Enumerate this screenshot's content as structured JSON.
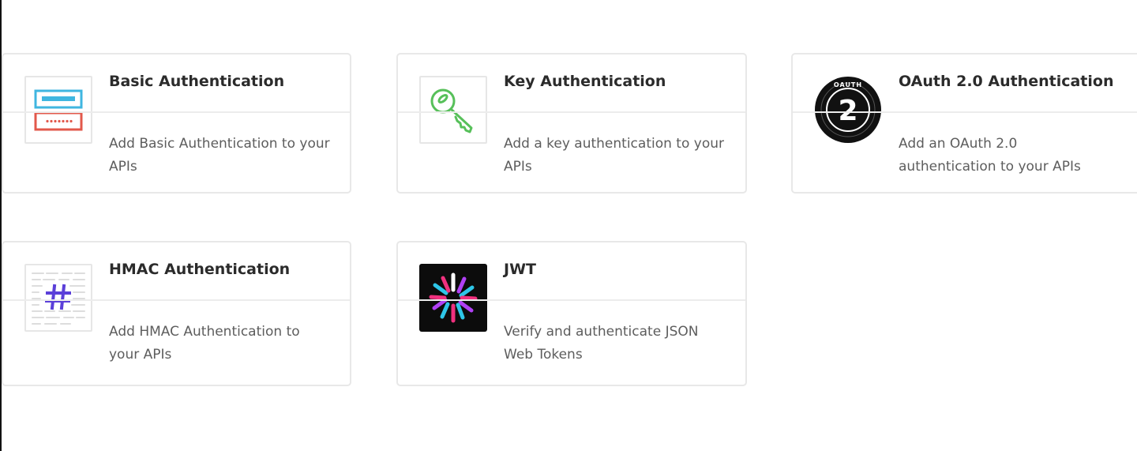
{
  "plugins": [
    {
      "title": "Basic Authentication",
      "description": "Add Basic Authentication to your APIs",
      "icon": "basic-auth-icon"
    },
    {
      "title": "Key Authentication",
      "description": "Add a key authentication to your APIs",
      "icon": "key-icon"
    },
    {
      "title": "OAuth 2.0 Authentication",
      "description": "Add an OAuth 2.0 authentication to your APIs",
      "icon": "oauth2-icon",
      "icon_text": "2",
      "badge_text": "OAUTH"
    },
    {
      "title": "HMAC Authentication",
      "description": "Add HMAC Authentication to your APIs",
      "icon": "hmac-hash-icon"
    },
    {
      "title": "JWT",
      "description": "Verify and authenticate JSON Web Tokens",
      "icon": "jwt-icon"
    }
  ],
  "colors": {
    "basic_blue": "#3fb6e0",
    "basic_red": "#e2584b",
    "key_green": "#57c05a",
    "hmac_purple": "#5b3fd9",
    "jwt_pink": "#f0307e",
    "jwt_cyan": "#2ec6e8",
    "jwt_purple": "#b041f5"
  }
}
